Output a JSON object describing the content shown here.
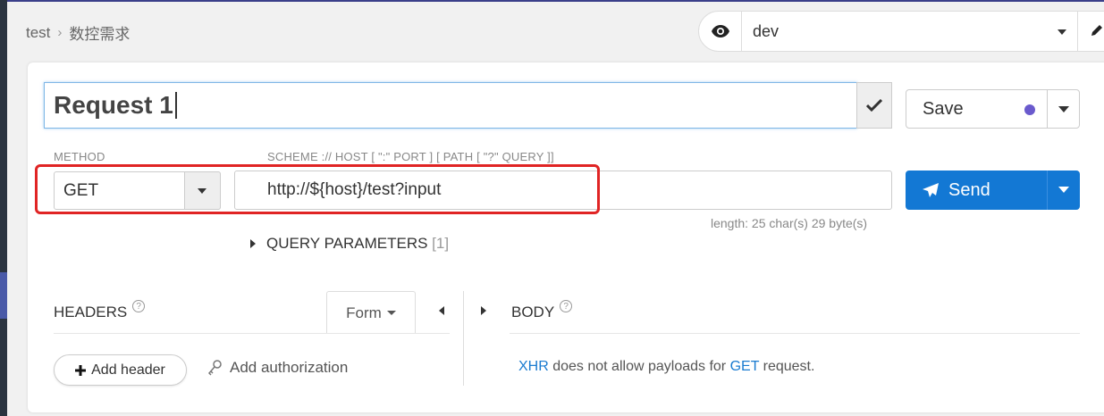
{
  "breadcrumb": {
    "project": "test",
    "page": "数控需求"
  },
  "environment": {
    "name": "dev",
    "eye_icon": "eye-icon",
    "edit_icon": "pencil-icon"
  },
  "request": {
    "title": "Request 1",
    "save_label": "Save",
    "method_label": "METHOD",
    "method": "GET",
    "url_hint": "SCHEME :// HOST [ \":\" PORT ] [ PATH [ \"?\" QUERY ]]",
    "url": "http://${host}/test?input",
    "send_label": "Send",
    "length_info": "length: 25 char(s) 29 byte(s)"
  },
  "query_params": {
    "label": "QUERY PARAMETERS",
    "count": "[1]"
  },
  "headers": {
    "label": "HEADERS",
    "help": "?",
    "form_label": "Form",
    "add_header_label": "Add header",
    "add_auth_label": "Add authorization"
  },
  "body": {
    "label": "BODY",
    "help": "?",
    "msg_xhr": "XHR",
    "msg_mid": " does not allow payloads for ",
    "msg_method": "GET",
    "msg_end": " request."
  },
  "colors": {
    "primary": "#1378d4",
    "highlight_border": "#e02424",
    "unsaved_dot": "#6a5acd"
  }
}
